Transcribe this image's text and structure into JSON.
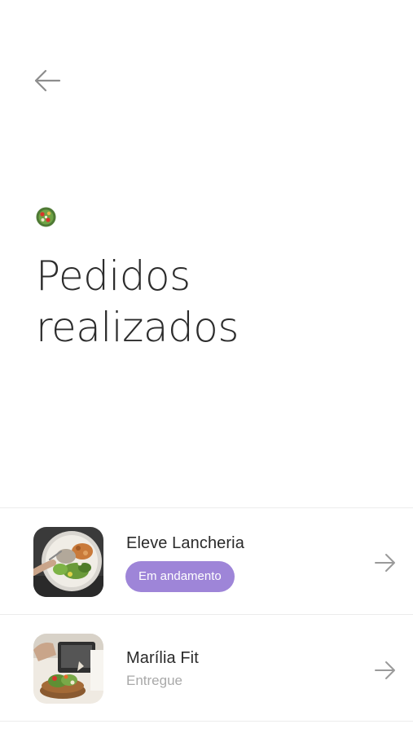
{
  "header": {
    "back_icon": "arrow-left-icon",
    "brand_icon": "salad-bowl-icon",
    "title_line1": "Pedidos",
    "title_line2": "realizados"
  },
  "orders": [
    {
      "name": "Eleve Lancheria",
      "status": "Em andamento",
      "status_style": "badge",
      "thumbnail": "salad-bowl-photo",
      "arrow_icon": "arrow-right-icon"
    },
    {
      "name": "Marília Fit",
      "status": "Entregue",
      "status_style": "text",
      "thumbnail": "salad-plate-photo",
      "arrow_icon": "arrow-right-icon"
    }
  ],
  "colors": {
    "accent_badge": "#9e85d8",
    "muted_text": "#a9a9a9",
    "title_text": "#2c2c2c",
    "divider": "#ececec"
  }
}
